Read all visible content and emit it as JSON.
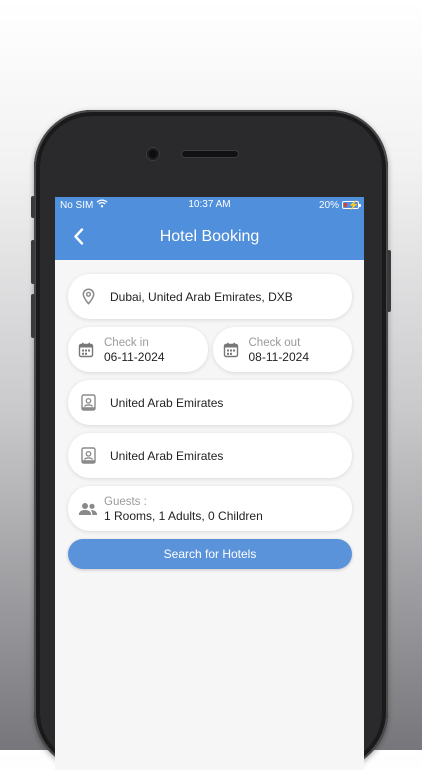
{
  "status_bar": {
    "carrier": "No SIM",
    "time": "10:37 AM",
    "battery": "20%",
    "battery_level": 0.2
  },
  "header": {
    "title": "Hotel Booking",
    "back_icon": "chevron-left-icon"
  },
  "form": {
    "destination": "Dubai, United Arab Emirates, DXB",
    "check_in": {
      "label": "Check in",
      "value": "06-11-2024"
    },
    "check_out": {
      "label": "Check out",
      "value": "08-11-2024"
    },
    "nationality": "United Arab Emirates",
    "residence": "United Arab Emirates",
    "guests": {
      "label": "Guests :",
      "value": "1 Rooms, 1 Adults, 0 Children"
    },
    "search_label": "Search for Hotels"
  },
  "colors": {
    "header": "#4f8fdb",
    "button": "#5b93db",
    "background": "#f6f6f7",
    "battery_low": "#e53935"
  }
}
